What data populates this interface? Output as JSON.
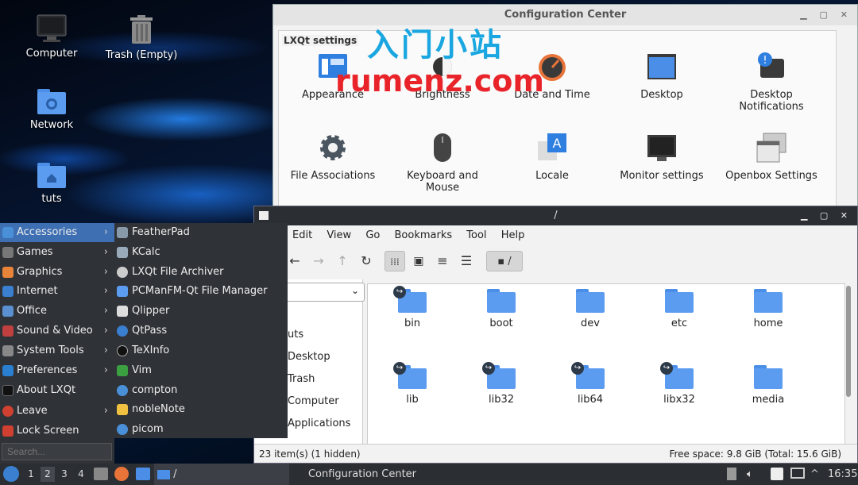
{
  "desktop": {
    "icons": [
      {
        "label": "Computer"
      },
      {
        "label": "Trash (Empty)"
      },
      {
        "label": "Network"
      },
      {
        "label": "tuts"
      }
    ]
  },
  "watermark": {
    "line1": "入门小站",
    "line2": "rumenz.com"
  },
  "config_center": {
    "title": "Configuration Center",
    "group_label": "LXQt settings",
    "items": [
      {
        "label": "Appearance",
        "icon": "appearance-icon"
      },
      {
        "label": "Brightness",
        "icon": "brightness-icon"
      },
      {
        "label": "Date and Time",
        "icon": "clock-icon"
      },
      {
        "label": "Desktop",
        "icon": "desktop-icon"
      },
      {
        "label": "Desktop Notifications",
        "icon": "notification-icon"
      },
      {
        "label": "File Associations",
        "icon": "gear-icon"
      },
      {
        "label": "Keyboard and Mouse",
        "icon": "mouse-icon"
      },
      {
        "label": "Locale",
        "icon": "locale-icon"
      },
      {
        "label": "Monitor settings",
        "icon": "monitor-icon"
      },
      {
        "label": "Openbox Settings",
        "icon": "openbox-icon"
      }
    ]
  },
  "file_manager": {
    "title": "/",
    "menus": [
      "Edit",
      "View",
      "Go",
      "Bookmarks",
      "Tool",
      "Help"
    ],
    "path": "/",
    "side_items": [
      "uts",
      "Desktop",
      "Trash",
      "Computer",
      "Applications"
    ],
    "files": [
      {
        "name": "bin",
        "link": true
      },
      {
        "name": "boot",
        "link": false
      },
      {
        "name": "dev",
        "link": false
      },
      {
        "name": "etc",
        "link": false
      },
      {
        "name": "home",
        "link": false
      },
      {
        "name": "lib",
        "link": true
      },
      {
        "name": "lib32",
        "link": true
      },
      {
        "name": "lib64",
        "link": true
      },
      {
        "name": "libx32",
        "link": true
      },
      {
        "name": "media",
        "link": false
      }
    ],
    "status_left": "23 item(s) (1 hidden)",
    "status_right": "Free space: 9.8 GiB (Total: 15.6 GiB)"
  },
  "app_menu": {
    "categories": [
      {
        "label": "Accessories",
        "arrow": true,
        "selected": true,
        "color": "#4a90d9"
      },
      {
        "label": "Games",
        "arrow": true,
        "color": "#777777"
      },
      {
        "label": "Graphics",
        "arrow": true,
        "color": "#e8843a"
      },
      {
        "label": "Internet",
        "arrow": true,
        "color": "#3a7fd0"
      },
      {
        "label": "Office",
        "arrow": true,
        "color": "#5a8fd0"
      },
      {
        "label": "Sound & Video",
        "arrow": true,
        "color": "#c04040"
      },
      {
        "label": "System Tools",
        "arrow": true,
        "color": "#888888"
      },
      {
        "label": "Preferences",
        "arrow": true,
        "color": "#2a7fd0"
      },
      {
        "label": "About LXQt",
        "arrow": false,
        "color": "#222222"
      },
      {
        "label": "Leave",
        "arrow": true,
        "color": "#d04030"
      },
      {
        "label": "Lock Screen",
        "arrow": false,
        "color": "#d04030"
      }
    ],
    "search_placeholder": "Search...",
    "accessories": [
      {
        "label": "FeatherPad",
        "color": "#8899aa"
      },
      {
        "label": "KCalc",
        "color": "#99aabb"
      },
      {
        "label": "LXQt File Archiver",
        "color": "#cccccc"
      },
      {
        "label": "PCManFM-Qt File Manager",
        "color": "#5b9cf0"
      },
      {
        "label": "Qlipper",
        "color": "#dddddd"
      },
      {
        "label": "QtPass",
        "color": "#3a7fd0"
      },
      {
        "label": "TeXInfo",
        "color": "#111111"
      },
      {
        "label": "Vim",
        "color": "#3aa040"
      },
      {
        "label": "compton",
        "color": "#4a90d9"
      },
      {
        "label": "nobleNote",
        "color": "#f0c040"
      },
      {
        "label": "picom",
        "color": "#4a90d9"
      }
    ]
  },
  "taskbar": {
    "workspaces": [
      "1",
      "2",
      "3",
      "4"
    ],
    "active_workspace": "2",
    "task_fm": "/",
    "task_cfg": "Configuration Center",
    "clock": "16:35"
  }
}
